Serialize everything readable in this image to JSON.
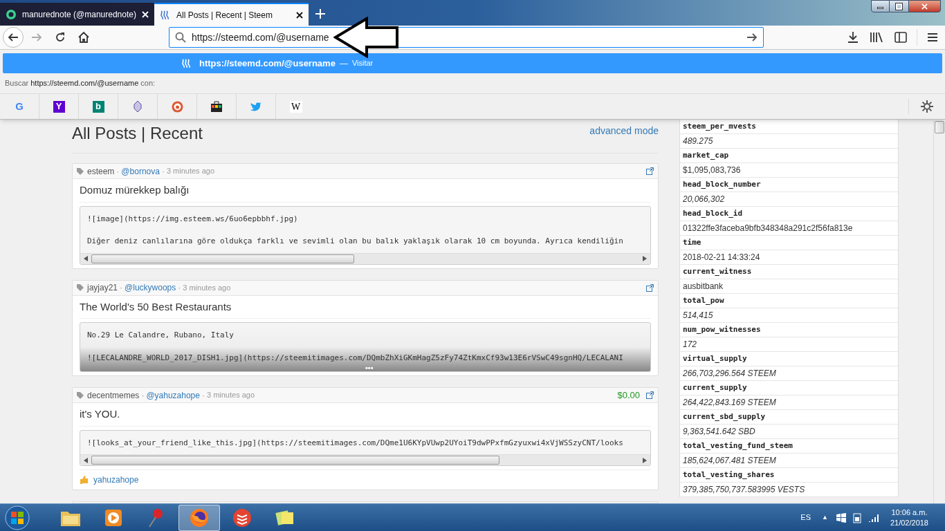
{
  "browser": {
    "tabs": [
      {
        "title": "manurednote (@manurednote)",
        "selected": false,
        "kind": "circle"
      },
      {
        "title": "All Posts | Recent | Steem",
        "selected": true,
        "kind": "steem"
      }
    ],
    "url": "https://steemd.com/@username",
    "suggestion": {
      "url": "https://steemd.com/@username",
      "separator": "—",
      "action": "Visitar"
    },
    "search_row": {
      "prefix": "Buscar",
      "query": "https://steemd.com/@username",
      "suffix": "con:"
    },
    "engines": [
      {
        "kind": "google",
        "label": "G"
      },
      {
        "kind": "yahoo",
        "label": "Y"
      },
      {
        "kind": "bing",
        "label": "b"
      },
      {
        "kind": "crest"
      },
      {
        "kind": "duck"
      },
      {
        "kind": "bag"
      },
      {
        "kind": "bird"
      },
      {
        "kind": "wiki",
        "label": "W"
      }
    ]
  },
  "page": {
    "title": "All Posts | Recent",
    "advanced_link": "advanced mode",
    "meta_separator": "·",
    "posts": [
      {
        "tag": "esteem",
        "author": "@bornova",
        "time": "3 minutes ago",
        "title": "Domuz mürekkep balığı",
        "kind": "scroll",
        "lines": [
          "![image](https://img.esteem.ws/6uo6epbbhf.jpg)",
          "Diğer deniz canlılarına göre oldukça farklı ve sevimli olan bu balık yaklaşık olarak 10 cm boyunda. Ayrıca kendiliğin"
        ]
      },
      {
        "tag": "jayjay21",
        "author": "@luckywoops",
        "time": "3 minutes ago",
        "title": "The World's 50 Best Restaurants",
        "kind": "collapsed",
        "more": "•••",
        "lines": [
          "No.29 Le Calandre, Rubano, Italy",
          "![LECALANDRE_WORLD_2017_DISH1.jpg](https://steemitimages.com/DQmbZhXiGKmHagZ5zFy74ZtKmxCf93w13E6rVSwC49sgnHQ/LECALANI"
        ]
      },
      {
        "tag": "decentmemes",
        "author": "@yahuzahope",
        "time": "3 minutes ago",
        "title": "it's YOU.",
        "kind": "scroll",
        "payout": "$0.00",
        "voter": "yahuzahope",
        "lines": [
          "![looks_at_your_friend_like_this.jpg](https://steemitimages.com/DQme1U6KYpVUwp2UYoiT9dwPPxfmGzyuxwi4xVjWSSzyCNT/looks"
        ]
      }
    ],
    "stats": [
      {
        "key": "steem_per_mvests",
        "value": "489.275",
        "italic": true
      },
      {
        "key": "market_cap",
        "value": "$1,095,083,736",
        "italic": false
      },
      {
        "key": "head_block_number",
        "value": "20,066,302",
        "italic": true
      },
      {
        "key": "head_block_id",
        "value": "01322ffe3faceba9bfb348348a291c2f56fa813e",
        "italic": false
      },
      {
        "key": "time",
        "value": "2018-02-21 14:33:24",
        "italic": false
      },
      {
        "key": "current_witness",
        "value": "ausbitbank",
        "italic": false
      },
      {
        "key": "total_pow",
        "value": "514,415",
        "italic": true
      },
      {
        "key": "num_pow_witnesses",
        "value": "172",
        "italic": true
      },
      {
        "key": "virtual_supply",
        "value": "266,703,296.564 STEEM",
        "italic": true
      },
      {
        "key": "current_supply",
        "value": "264,422,843.169 STEEM",
        "italic": true
      },
      {
        "key": "current_sbd_supply",
        "value": "9,363,541.642 SBD",
        "italic": true
      },
      {
        "key": "total_vesting_fund_steem",
        "value": "185,624,067.481 STEEM",
        "italic": true
      },
      {
        "key": "total_vesting_shares",
        "value": "379,385,750,737.583995 VESTS",
        "italic": true
      }
    ]
  },
  "taskbar": {
    "apps": [
      {
        "kind": "folder",
        "selected": false
      },
      {
        "kind": "media",
        "selected": false
      },
      {
        "kind": "pin",
        "selected": false
      },
      {
        "kind": "firefox",
        "selected": true
      },
      {
        "kind": "todo",
        "selected": false
      },
      {
        "kind": "notes",
        "selected": false
      }
    ],
    "language": "ES",
    "tray_arrow": "▲",
    "time": "10:06 a.m.",
    "date": "21/02/2018"
  }
}
